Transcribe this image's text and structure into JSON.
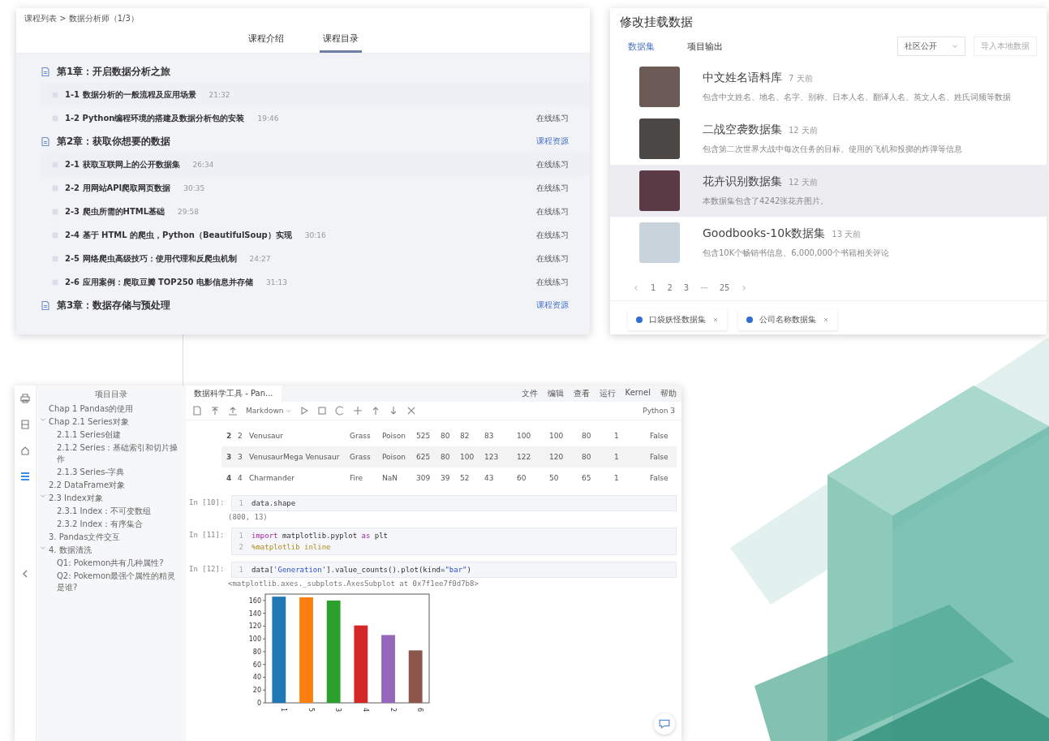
{
  "course_panel": {
    "breadcrumb": "课程列表 > 数据分析师（1/3）",
    "tabs": [
      {
        "label": "课程介绍",
        "selected": false
      },
      {
        "label": "课程目录",
        "selected": true
      }
    ],
    "chapters": [
      {
        "title": "第1章：开启数据分析之旅",
        "lessons": [
          {
            "title": "1-1 数据分析的一般流程及应用场景",
            "duration": "21:32"
          },
          {
            "title": "1-2 Python编程环境的搭建及数据分析包的安装",
            "duration": "19:46",
            "action": "在线练习"
          }
        ]
      },
      {
        "title": "第2章：获取你想要的数据",
        "action": "课程资源",
        "lessons": [
          {
            "title": "2-1 获取互联网上的公开数据集",
            "duration": "26:34",
            "action": "在线练习"
          },
          {
            "title": "2-2 用网站API爬取网页数据",
            "duration": "30:35",
            "action": "在线练习"
          },
          {
            "title": "2-3 爬虫所需的HTML基础",
            "duration": "29:58",
            "action": "在线练习"
          },
          {
            "title": "2-4 基于 HTML 的爬虫，Python（BeautifulSoup）实现",
            "duration": "30:16",
            "action": "在线练习"
          },
          {
            "title": "2-5 网络爬虫高级技巧：使用代理和反爬虫机制",
            "duration": "24:27",
            "action": "在线练习"
          },
          {
            "title": "2-6 应用案例：爬取豆瓣 TOP250 电影信息并存储",
            "duration": "31:13",
            "action": "在线练习"
          }
        ]
      },
      {
        "title": "第3章：数据存储与预处理",
        "action": "课程资源"
      }
    ]
  },
  "dataset_dialog": {
    "title": "修改挂载数据",
    "tabs": [
      {
        "label": "数据集",
        "selected": true
      },
      {
        "label": "项目输出",
        "selected": false
      }
    ],
    "filter": "社区公开",
    "import_button": "导入本地数据",
    "datasets": [
      {
        "title": "中文姓名语料库",
        "age": "7 天前",
        "description": "包含中文姓名、地名、名字、别称、日本人名、翻译人名、英文人名、姓氏词频等数据",
        "highlighted": false
      },
      {
        "title": "二战空袭数据集",
        "age": "12 天前",
        "description": "包含第二次世界大战中每次任务的目标、使用的飞机和投掷的炸弹等信息",
        "highlighted": false
      },
      {
        "title": "花卉识别数据集",
        "age": "12 天前",
        "description": "本数据集包含了4242张花卉图片。",
        "highlighted": true
      },
      {
        "title": "Goodbooks-10k数据集",
        "age": "13 天前",
        "description": "包含10K个畅销书信息、6,000,000个书籍相关评论",
        "highlighted": false
      }
    ],
    "pages": [
      "1",
      "2",
      "3",
      "···",
      "25"
    ],
    "mounted": [
      {
        "label": "口袋妖怪数据集"
      },
      {
        "label": "公司名称数据集"
      }
    ]
  },
  "notebook": {
    "sidebar_icons": [
      {
        "selected": false
      },
      {
        "selected": false
      },
      {
        "selected": false
      },
      {
        "selected": true
      }
    ],
    "tree": {
      "title": "项目目录",
      "items": [
        {
          "label": "Chap 1 Pandas的使用"
        },
        {
          "label": "Chap 2.1 Series对象",
          "expanded": true,
          "children": [
            {
              "label": "2.1.1 Series创建"
            },
            {
              "label": "2.1.2 Series：基础索引和切片操作"
            },
            {
              "label": "2.1.3 Series-字典"
            }
          ]
        },
        {
          "label": "2.2 DataFrame对象"
        },
        {
          "label": "2.3 Index对象",
          "expanded": true,
          "children": [
            {
              "label": "2.3.1 Index：不可变数组"
            },
            {
              "label": "2.3.2 Index：有序集合"
            }
          ]
        },
        {
          "label": "3. Pandas文件交互"
        },
        {
          "label": "4. 数据清洗",
          "expanded": true,
          "children": [
            {
              "label": "Q1: Pokemon共有几种属性?"
            },
            {
              "label": "Q2: Pokemon最强个属性的精灵是谁?"
            }
          ]
        }
      ]
    },
    "tab_title": "数据科学工具 - Pan...",
    "menu": [
      "文件",
      "编辑",
      "查看",
      "运行",
      "Kernel",
      "帮助"
    ],
    "cell_type": "Markdown",
    "kernel": "Python 3",
    "table_rows": [
      [
        "2",
        "2",
        "Venusaur",
        "Grass",
        "Poison",
        "525",
        "80",
        "82",
        "83",
        "100",
        "100",
        "80",
        "1",
        "False"
      ],
      [
        "3",
        "3",
        "VenusaurMega Venusaur",
        "Grass",
        "Poison",
        "625",
        "80",
        "100",
        "123",
        "122",
        "120",
        "80",
        "1",
        "False"
      ],
      [
        "4",
        "4",
        "Charmander",
        "Fire",
        "NaN",
        "309",
        "39",
        "52",
        "43",
        "60",
        "50",
        "65",
        "1",
        "False"
      ]
    ],
    "cells": [
      {
        "prompt": "In [10]:",
        "lines": [
          {
            "n": "1",
            "tokens": [
              {
                "text": "data.shape",
                "kind": "plain"
              }
            ]
          }
        ],
        "output": "(800, 13)"
      },
      {
        "prompt": "In [11]:",
        "lines": [
          {
            "n": "1",
            "tokens": [
              {
                "text": "import",
                "kind": "keyword"
              },
              {
                "text": " matplotlib.pyplot ",
                "kind": "plain"
              },
              {
                "text": "as",
                "kind": "keyword"
              },
              {
                "text": " plt",
                "kind": "plain"
              }
            ]
          },
          {
            "n": "2",
            "tokens": [
              {
                "text": "%matplotlib inline",
                "kind": "magic"
              }
            ]
          }
        ]
      },
      {
        "prompt": "In [12]:",
        "lines": [
          {
            "n": "1",
            "tokens": [
              {
                "text": "data[",
                "kind": "plain"
              },
              {
                "text": "'Generation'",
                "kind": "string"
              },
              {
                "text": "].value_counts().plot(kind=",
                "kind": "plain"
              },
              {
                "text": "\"bar\"",
                "kind": "string"
              },
              {
                "text": ")",
                "kind": "plain"
              }
            ]
          }
        ],
        "output": "<matplotlib.axes._subplots.AxesSubplot at 0x7f1ee7f0d7b8>",
        "chart_data": {
          "type": "bar",
          "categories": [
            "1",
            "5",
            "3",
            "4",
            "2",
            "6"
          ],
          "values": [
            166,
            165,
            160,
            121,
            106,
            82
          ],
          "ylim": [
            0,
            170
          ],
          "yticks": [
            0,
            20,
            40,
            60,
            80,
            100,
            120,
            140,
            160
          ]
        }
      }
    ]
  }
}
